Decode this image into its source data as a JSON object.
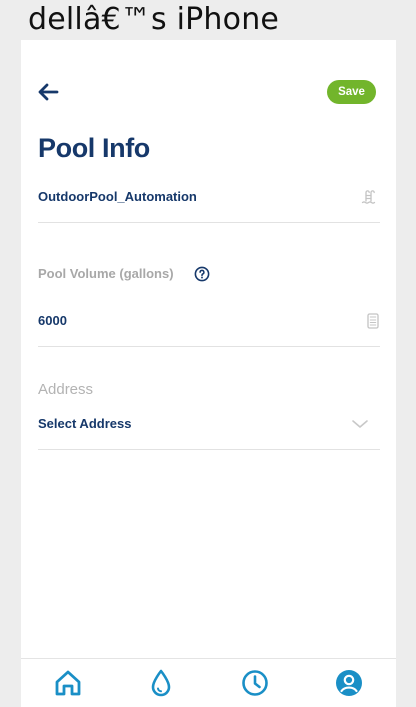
{
  "device": {
    "title": "dellâ€™s iPhone"
  },
  "header": {
    "back_icon": "arrow-left-icon",
    "save_label": "Save"
  },
  "page": {
    "title": "Pool Info"
  },
  "pool_name": {
    "value": "OutdoorPool_Automation",
    "icon": "pool-ladder-icon"
  },
  "pool_volume": {
    "label": "Pool Volume (gallons)",
    "help_icon": "question-circle-icon",
    "value": "6000",
    "icon": "calculator-icon"
  },
  "address": {
    "label": "Address",
    "value": "Select Address",
    "icon": "chevron-down-icon"
  },
  "tabbar": {
    "items": [
      {
        "name": "home",
        "icon": "home-icon"
      },
      {
        "name": "water",
        "icon": "water-drop-icon"
      },
      {
        "name": "schedule",
        "icon": "clock-icon"
      },
      {
        "name": "account",
        "icon": "user-circle-icon"
      }
    ]
  },
  "colors": {
    "background": "#ededed",
    "screen": "#ffffff",
    "primary": "#16386a",
    "accent_green": "#72b52b",
    "tab_icon": "#1a8fc6",
    "label_gray": "#a8a8a8",
    "divider": "#e2e2e2"
  }
}
